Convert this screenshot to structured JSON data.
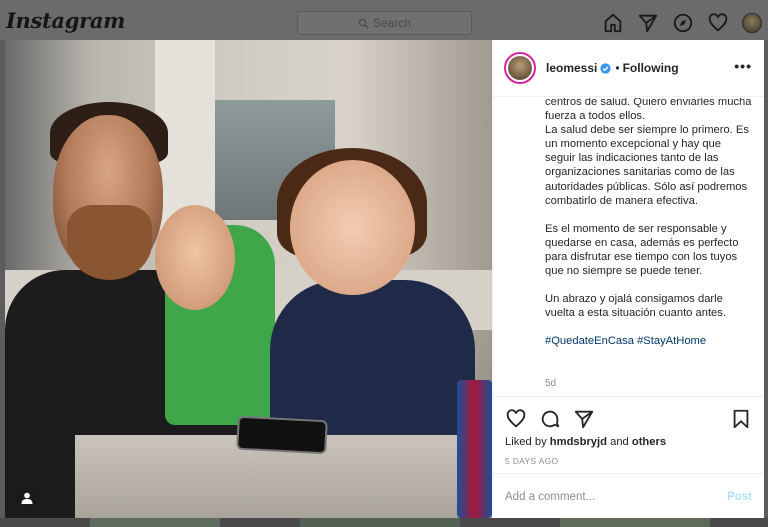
{
  "nav": {
    "logo": "Instagram",
    "search_placeholder": "Search",
    "icons": [
      "home-icon",
      "direct-icon",
      "explore-icon",
      "activity-heart-icon",
      "profile-avatar"
    ]
  },
  "post": {
    "username": "leomessi",
    "separator": "•",
    "follow_status": "Following",
    "more": "•••",
    "caption": {
      "paragraph1": "centros de salud. Quiero enviarles mucha fuerza a todos ellos.",
      "paragraph2": "La salud debe ser siempre lo primero. Es un momento excepcional y hay que seguir las indicaciones tanto de las organizaciones sanitarias como de las autoridades públicas. Sólo así podremos combatirlo de manera efectiva.",
      "paragraph3": "Es el momento de ser responsable y quedarse en casa, además es perfecto para disfrutar ese tiempo con los tuyos que no siempre se puede tener.",
      "paragraph4": "Un abrazo y ojalá consigamos darle vuelta a esta situación cuanto antes.",
      "hashtag1": "#QuedateEnCasa",
      "hashtag2": "#StayAtHome"
    },
    "age": "5d",
    "liked_by_prefix": "Liked by",
    "liked_by_user": "hmdsbryjd",
    "liked_by_and": "and",
    "liked_by_others": "others",
    "timestamp": "5 DAYS AGO",
    "comment_placeholder": "Add a comment...",
    "post_button": "Post"
  },
  "colors": {
    "verified": "#3897f0",
    "hashtag": "#00376b",
    "post_button_disabled": "#b2dffc",
    "story_ring": "#d6249f"
  }
}
